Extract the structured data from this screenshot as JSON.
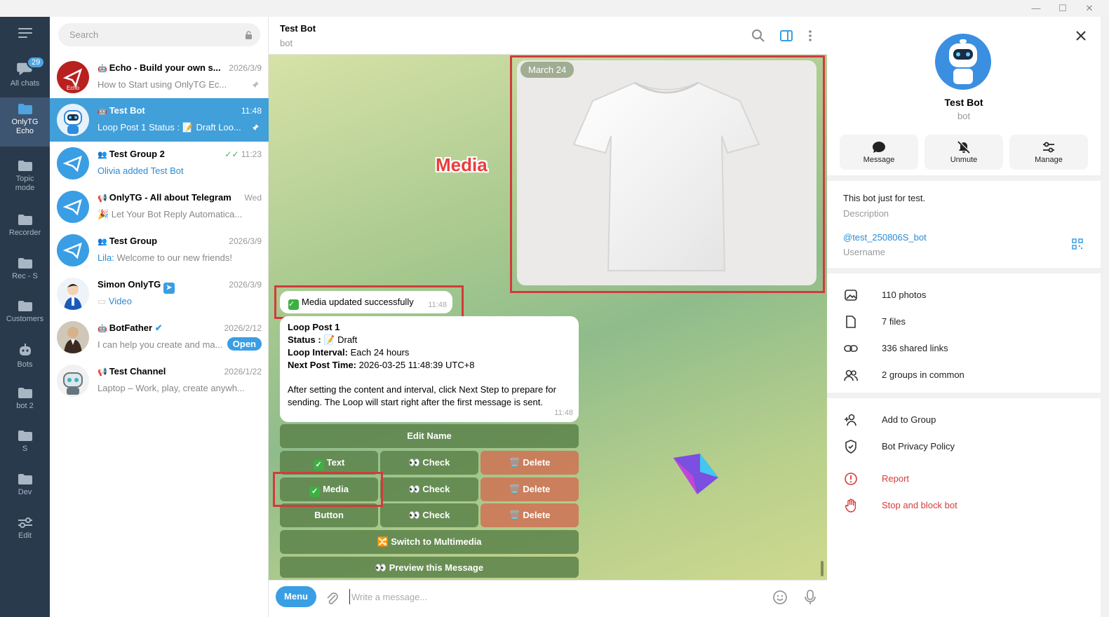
{
  "window": {
    "minimize": "—",
    "maximize": "☐",
    "close": "✕"
  },
  "folders": {
    "all_chats_label": "All chats",
    "all_chats_badge": "29",
    "items": [
      {
        "label": "OnlyTG\nEcho",
        "line1": "OnlyTG",
        "line2": "Echo"
      },
      {
        "line1": "Topic",
        "line2": "mode"
      },
      {
        "line1": "Recorder"
      },
      {
        "line1": "Rec - S"
      },
      {
        "line1": "Customers"
      },
      {
        "line1": "Bots"
      },
      {
        "line1": "bot 2"
      },
      {
        "line1": "S"
      },
      {
        "line1": "Dev"
      },
      {
        "line1": "Edit"
      }
    ]
  },
  "search": {
    "placeholder": "Search"
  },
  "chats": [
    {
      "name": "Echo - Build your own s...",
      "time": "2026/3/9",
      "preview": "How to Start using OnlyTG Ec...",
      "kind": "bot"
    },
    {
      "name": "Test Bot",
      "time": "11:48",
      "preview": "Loop Post 1 Status : 📝 Draft Loo...",
      "kind": "bot"
    },
    {
      "name": "Test Group 2",
      "time": "11:23",
      "preview": "Olivia added Test Bot",
      "kind": "group"
    },
    {
      "name": "OnlyTG - All about Telegram",
      "time": "Wed",
      "preview": "🎉 Let Your Bot Reply Automatica...",
      "kind": "channel"
    },
    {
      "name": "Test Group",
      "time": "2026/3/9",
      "preview_sender": "Lila:",
      "preview": "Welcome to our new friends!",
      "kind": "group"
    },
    {
      "name": "Simon OnlyTG",
      "time": "2026/3/9",
      "preview": "Video",
      "kind": "user"
    },
    {
      "name": "BotFather",
      "time": "2026/2/12",
      "preview": "I can help you create and ma...",
      "open_label": "Open",
      "kind": "bot"
    },
    {
      "name": "Test Channel",
      "time": "2026/1/22",
      "preview": "Laptop – Work, play, create anywh...",
      "kind": "channel"
    }
  ],
  "chat_header": {
    "title": "Test Bot",
    "subtitle": "bot"
  },
  "messages": {
    "date_chip": "March 24",
    "annotation": "Media",
    "status_text": "Media updated successfully",
    "status_time": "11:48",
    "post": {
      "line1": "Loop Post 1",
      "status_key": "Status :",
      "status_val": "📝 Draft",
      "interval_key": "Loop Interval:",
      "interval_val": "Each 24 hours",
      "next_key": "Next Post Time:",
      "next_val": "2026-03-25 11:48:39 UTC+8",
      "para1": "After setting the content and interval, click Next Step to prepare for",
      "para2": "sending. The Loop will start right after the first message is sent.",
      "time": "11:48"
    },
    "buttons": {
      "edit_name": "Edit Name",
      "text": "Text",
      "check": "👀 Check",
      "delete": "🗑️ Delete",
      "media": "Media",
      "button": "Button",
      "switch": "🔀 Switch to Multimedia",
      "preview": "👀 Preview this Message"
    }
  },
  "input": {
    "menu_label": "Menu",
    "placeholder": "Write a message..."
  },
  "info": {
    "name": "Test Bot",
    "subtitle": "bot",
    "actions": {
      "message": "Message",
      "unmute": "Unmute",
      "manage": "Manage"
    },
    "description": "This bot just for test.",
    "description_label": "Description",
    "username": "@test_250806S_bot",
    "username_label": "Username",
    "media_rows": [
      "110 photos",
      "7 files",
      "336 shared links",
      "2 groups in common"
    ],
    "add_to_group": "Add to Group",
    "privacy": "Bot Privacy Policy",
    "report": "Report",
    "stop_block": "Stop and block bot"
  },
  "colors": {
    "accent": "#419fd9",
    "sidebar": "#2a3a4d",
    "danger": "#d63a3a",
    "annotation_red": "#d23b3b"
  }
}
